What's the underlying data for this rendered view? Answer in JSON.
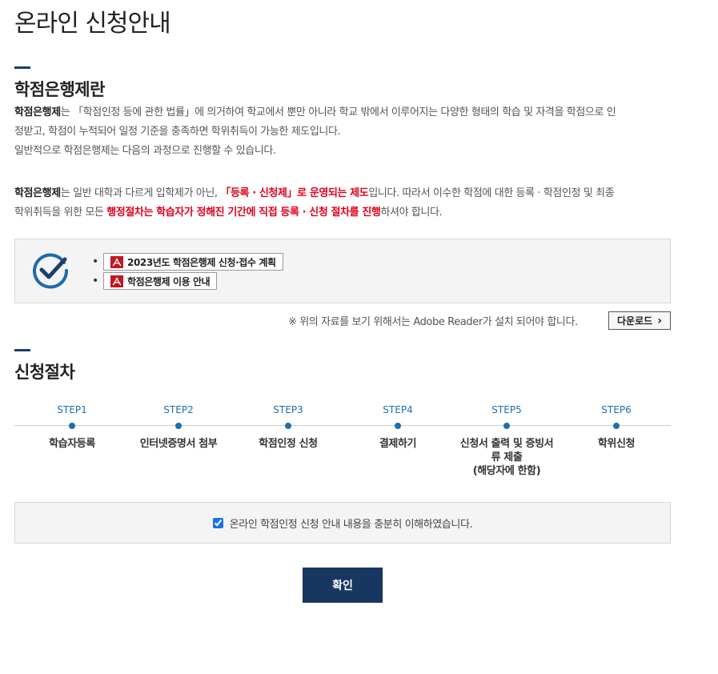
{
  "page_title": "온라인 신청안내",
  "section1": {
    "title": "학점은행제란",
    "para1": {
      "term": "학점은행제",
      "line1_rest": "는 「학점인정 등에 관한 법률」에 의거하여 학교에서 뿐만 아니라 학교 밖에서 이루어지는 다양한 형태의 학습 및 자격을 학점으로 인",
      "line2": "정받고, 학점이 누적되어 일정 기준을 충족하면 학위취득이 가능한 제도입니다.",
      "line3": "일반적으로 학점은행제는 다음의 과정으로 진행할 수 있습니다."
    },
    "para2": {
      "term": "학점은행제",
      "part1": "는 일반 대학과 다르게 입학제가 아닌, ",
      "red1": "「등록 · 신청제」로 운영되는 제도",
      "part2": "입니다. 따라서 이수한 학점에 대한 등록 · 학점인정 및 최종",
      "part3": "학위취득을 위한 모든 ",
      "red2": "행정절차는 학습자가 정해진 기간에 직접 등록 · 신청 절차를 진행",
      "part4": "하셔야 합니다."
    }
  },
  "docs": {
    "items": [
      {
        "label": "2023년도 학점은행제 신청·접수 계획"
      },
      {
        "label": "학점은행제 이용 안내"
      }
    ],
    "note": "※ 위의 자료를 보기 위해서는 Adobe Reader가 설치 되어야 합니다.",
    "download_label": "다운로드",
    "download_arrow": "›"
  },
  "section2": {
    "title": "신청절차",
    "steps": [
      {
        "num": "STEP1",
        "label": "학습자등록"
      },
      {
        "num": "STEP2",
        "label": "인터넷증명서 첨부"
      },
      {
        "num": "STEP3",
        "label": "학점인정 신청"
      },
      {
        "num": "STEP4",
        "label": "결제하기"
      },
      {
        "num": "STEP5",
        "label": "신청서 출력 및 증빙서\n류 제출\n(해당자에 한함)"
      },
      {
        "num": "STEP6",
        "label": "학위신청"
      }
    ]
  },
  "agree": {
    "label": "온라인 학점인정 신청 안내 내용을 충분히 이해하였습니다.",
    "checked": true
  },
  "confirm_label": "확인",
  "colors": {
    "accent_navy": "#173761",
    "step_blue": "#1e6fb0",
    "highlight_red": "#e0001b"
  }
}
